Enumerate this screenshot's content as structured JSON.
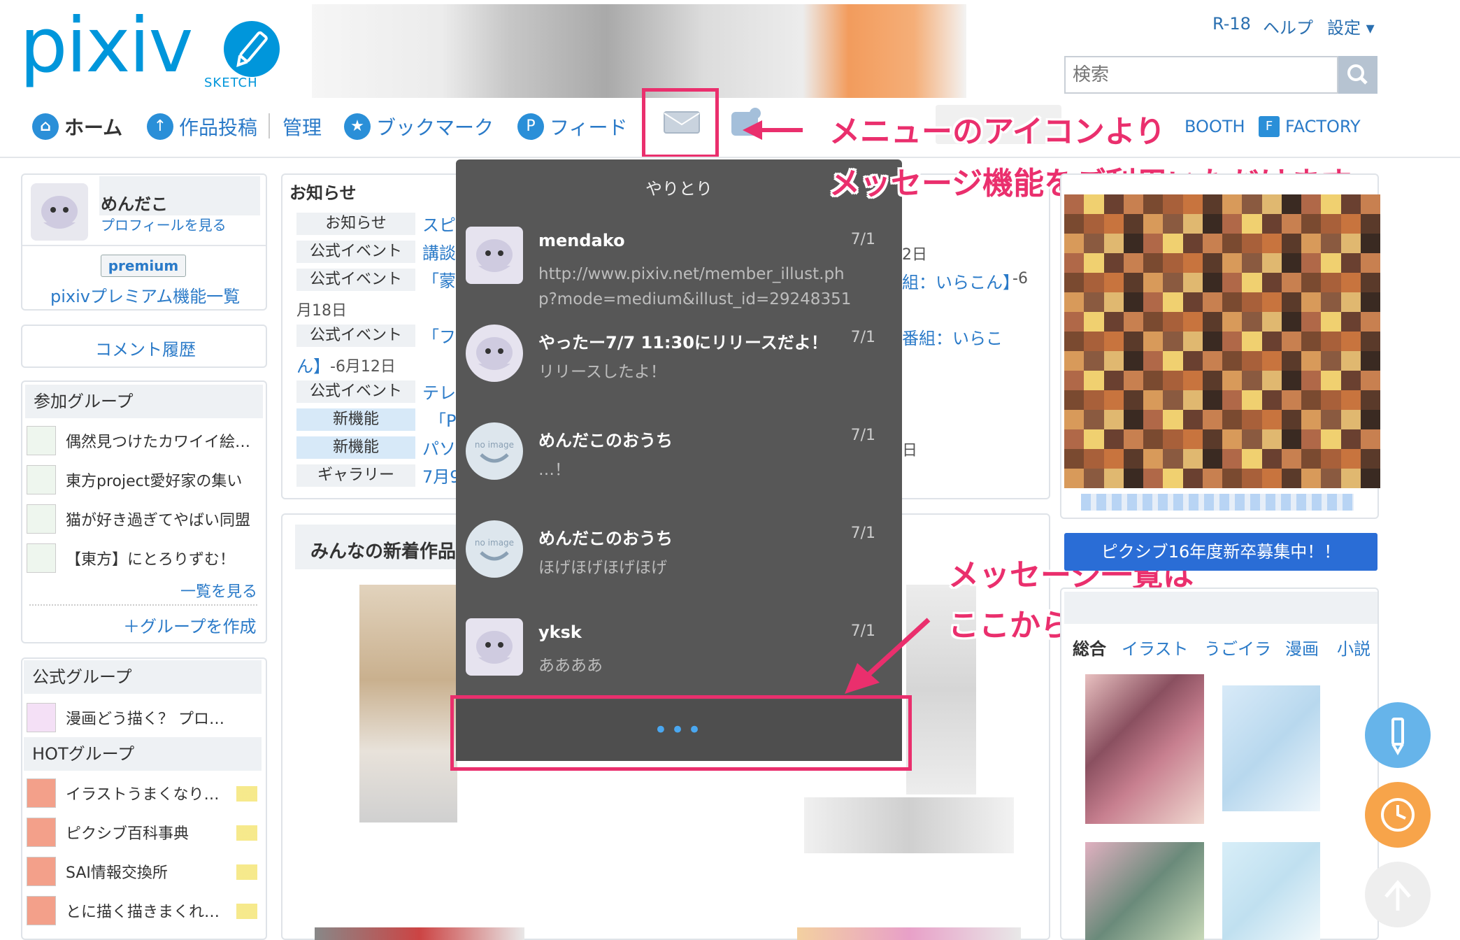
{
  "header": {
    "logo_text": "pixiv",
    "logo_sub": "SKETCH",
    "top_links": [
      "R-18",
      "ヘルプ",
      "設定 ▾"
    ],
    "search_placeholder": "検索"
  },
  "nav": {
    "home": "ホーム",
    "upload": "作品投稿",
    "manage": "管理",
    "bookmark": "ブックマーク",
    "feed": "フィード",
    "booth": "BOOTH",
    "factory": "FACTORY"
  },
  "profile": {
    "name": "めんだこ",
    "view_profile": "プロフィールを見る",
    "premium_badge": "premium",
    "premium_link": "pixivプレミアム機能一覧",
    "comment_history": "コメント履歴"
  },
  "groups": {
    "joined_title": "参加グループ",
    "joined": [
      "偶然見つけたカワイイ絵…",
      "東方project愛好家の集い",
      "猫が好き過ぎてやばい同盟",
      "【東方】にとろりずむ！"
    ],
    "see_all": "一覧を見る",
    "create": "＋グループを作成",
    "official_title": "公式グループ",
    "official": [
      "漫画どう描く？ プロ…"
    ],
    "hot_title": "HOTグループ",
    "hot": [
      "イラストうまくなり…",
      "ピクシブ百科事典",
      "SAI情報交換所",
      "とに描く描きまくれ…"
    ]
  },
  "news": {
    "title": "お知らせ",
    "rows": [
      {
        "tag": "お知らせ",
        "text": "スピ",
        "type": "normal"
      },
      {
        "tag": "公式イベント",
        "text": "講談",
        "type": "normal"
      },
      {
        "tag": "公式イベント",
        "text": "「蒙",
        "type": "normal"
      },
      {
        "tag": "公式イベント",
        "text": "「フ",
        "type": "normal"
      },
      {
        "tag": "公式イベント",
        "text": "テレ",
        "type": "normal"
      },
      {
        "tag": "新機能",
        "text": "「Pa",
        "type": "new"
      },
      {
        "tag": "新機能",
        "text": "パソ",
        "type": "new"
      },
      {
        "tag": "ギャラリー",
        "text": "7月9",
        "type": "normal"
      }
    ],
    "date_1": "月18日",
    "wrap_2a": "ん】",
    "date_2": "-6月12日",
    "right_1": "2日",
    "right_2": "組：いらこん】",
    "right_2b": "-6",
    "right_3": "番組：いらこ",
    "right_4": "日",
    "new_works_title": "みんなの新着作品"
  },
  "messages": {
    "title": "やりとり",
    "items": [
      {
        "name": "mendako",
        "date": "7/1",
        "body": "http://www.pixiv.net/member_illust.php?mode=medium&illust_id=29248351",
        "avatar": "octopus-avatar"
      },
      {
        "name": "やったー7/7 11:30にリリースだよ！",
        "date": "7/1",
        "body": "リリースしたよ！",
        "avatar": "octopus-avatar"
      },
      {
        "name": "めんだこのおうち",
        "date": "7/1",
        "body": "…！",
        "avatar": "no-image-avatar"
      },
      {
        "name": "めんだこのおうち",
        "date": "7/1",
        "body": "ほげほげほげほげ",
        "avatar": "no-image-avatar"
      },
      {
        "name": "yksk",
        "date": "7/1",
        "body": "ああああ",
        "avatar": "octopus-avatar"
      }
    ],
    "more": "•••",
    "no_image_label": "no image"
  },
  "annotations": {
    "line1": "メニューのアイコンより",
    "line2": "メッセージ機能をご利用いただけます。",
    "line3": "メッセージ一覧は",
    "line4": "ここから確認できます。"
  },
  "right": {
    "recruit": "ピクシブ16年度新卒募集中！！",
    "ranking_tabs": [
      "総合",
      "イラスト",
      "うごイラ",
      "漫画",
      "小説"
    ]
  },
  "colors": {
    "brand": "#0096db",
    "link": "#2a7ac8",
    "highlight": "#ea2f6d",
    "dropdown": "#575757"
  }
}
